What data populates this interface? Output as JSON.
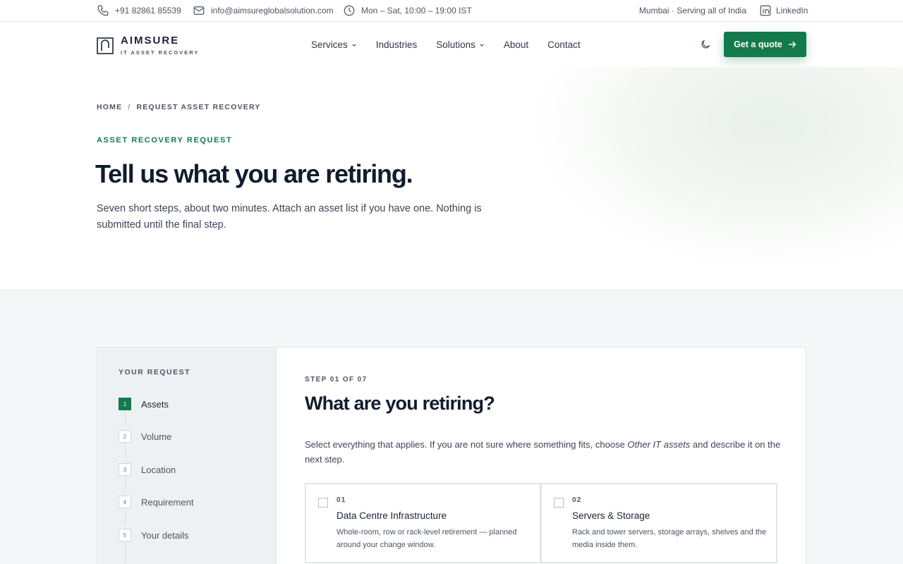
{
  "topbar": {
    "phone": "+91 82861 85539",
    "email": "info@aimsureglobalsolution.com",
    "hours": "Mon – Sat, 10:00 – 19:00 IST",
    "location": "Mumbai · Serving all of India",
    "linkedin": "LinkedIn"
  },
  "brand": {
    "name": "AIMSURE",
    "tagline": "IT ASSET RECOVERY"
  },
  "nav": {
    "items": [
      {
        "label": "Services",
        "has_dropdown": true
      },
      {
        "label": "Industries",
        "has_dropdown": false
      },
      {
        "label": "Solutions",
        "has_dropdown": true
      },
      {
        "label": "About",
        "has_dropdown": false
      },
      {
        "label": "Contact",
        "has_dropdown": false
      }
    ],
    "cta_label": "Get a quote"
  },
  "hero": {
    "breadcrumb": {
      "home": "HOME",
      "separator": "/",
      "current": "REQUEST ASSET RECOVERY"
    },
    "eyebrow": "ASSET RECOVERY REQUEST",
    "title": "Tell us what you are retiring.",
    "subtitle": "Seven short steps, about two minutes. Attach an asset list if you have one. Nothing is submitted until the final step."
  },
  "sidebar": {
    "title": "YOUR REQUEST",
    "steps": [
      {
        "num": "1",
        "label": "Assets",
        "active": true
      },
      {
        "num": "2",
        "label": "Volume",
        "active": false
      },
      {
        "num": "3",
        "label": "Location",
        "active": false
      },
      {
        "num": "4",
        "label": "Requirement",
        "active": false
      },
      {
        "num": "5",
        "label": "Your details",
        "active": false
      }
    ]
  },
  "form": {
    "step_count": "STEP 01 OF 07",
    "title": "What are you retiring?",
    "desc_before": "Select everything that applies. If you are not sure where something fits, choose ",
    "desc_emph": "Other IT assets",
    "desc_after": " and describe it on the next step.",
    "options": [
      {
        "num": "01",
        "title": "Data Centre Infrastructure",
        "desc": "Whole-room, row or rack-level retirement — planned around your change window.",
        "checked": false
      },
      {
        "num": "02",
        "title": "Servers & Storage",
        "desc": "Rack and tower servers, storage arrays, shelves and the media inside them.",
        "checked": false
      }
    ]
  },
  "colors": {
    "accent": "#137a4b",
    "text_dark": "#111c2d",
    "text_muted": "#4a5563",
    "section_bg": "#f5f7f9",
    "sidebar_bg": "#eef1f4"
  },
  "icons": [
    "phone-icon",
    "mail-icon",
    "clock-icon",
    "linkedin-icon",
    "logo-mark-icon",
    "chevron-down-icon",
    "moon-icon",
    "arrow-right-icon"
  ]
}
